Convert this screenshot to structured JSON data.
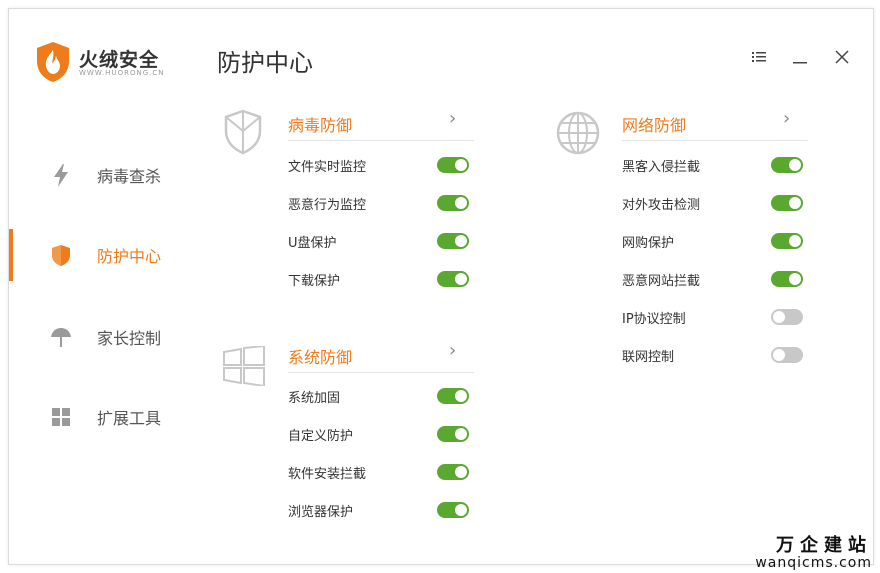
{
  "brand": {
    "name": "火绒安全",
    "sub": "WWW.HUORONG.CN"
  },
  "page_title": "防护中心",
  "window_controls": {
    "menu": "☰",
    "minimize": "—",
    "close": "✕"
  },
  "sidebar": {
    "items": [
      {
        "label": "病毒查杀",
        "icon": "lightning-icon",
        "active": false
      },
      {
        "label": "防护中心",
        "icon": "shield-icon",
        "active": true
      },
      {
        "label": "家长控制",
        "icon": "umbrella-icon",
        "active": false
      },
      {
        "label": "扩展工具",
        "icon": "grid-icon",
        "active": false
      }
    ]
  },
  "sections": {
    "virus": {
      "title": "病毒防御",
      "icon": "shield-outline-icon",
      "items": [
        {
          "label": "文件实时监控",
          "on": true
        },
        {
          "label": "恶意行为监控",
          "on": true
        },
        {
          "label": "U盘保护",
          "on": true
        },
        {
          "label": "下载保护",
          "on": true
        }
      ]
    },
    "system": {
      "title": "系统防御",
      "icon": "windows-icon",
      "items": [
        {
          "label": "系统加固",
          "on": true
        },
        {
          "label": "自定义防护",
          "on": true
        },
        {
          "label": "软件安装拦截",
          "on": true
        },
        {
          "label": "浏览器保护",
          "on": true
        }
      ]
    },
    "network": {
      "title": "网络防御",
      "icon": "globe-icon",
      "items": [
        {
          "label": "黑客入侵拦截",
          "on": true
        },
        {
          "label": "对外攻击检测",
          "on": true
        },
        {
          "label": "网购保护",
          "on": true
        },
        {
          "label": "恶意网站拦截",
          "on": true
        },
        {
          "label": "IP协议控制",
          "on": false
        },
        {
          "label": "联网控制",
          "on": false
        }
      ]
    }
  },
  "colors": {
    "accent": "#ef7b1a",
    "toggle_on": "#5aa830",
    "toggle_off": "#c8c8c8"
  },
  "watermark": {
    "cn": "万企建站",
    "en": "wanqicms.com"
  }
}
